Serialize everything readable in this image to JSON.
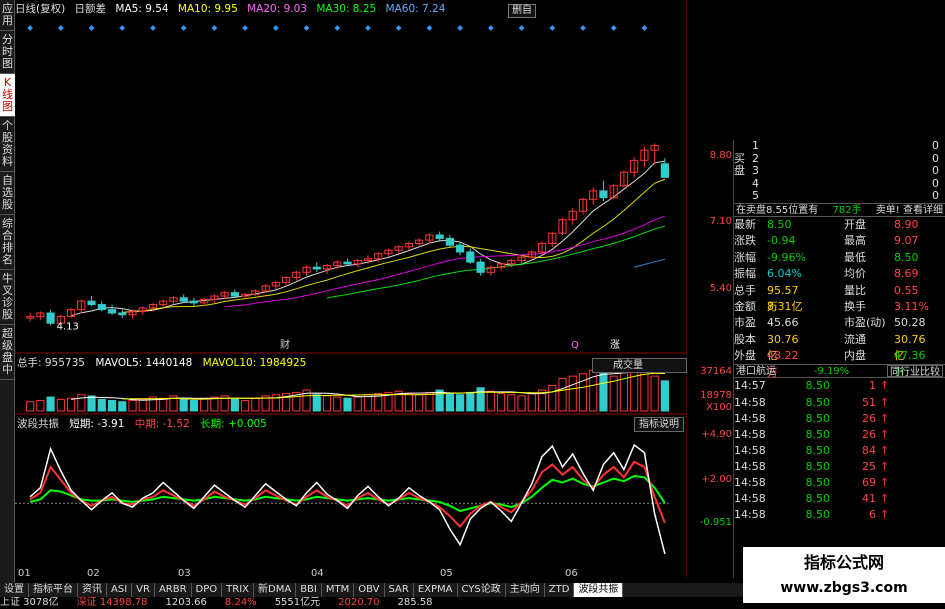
{
  "side_tabs": [
    "应用",
    "分时图",
    "K线图",
    "个股资料",
    "自选股",
    "综合排名",
    "牛叉诊股",
    "超级盘中"
  ],
  "side_active": 2,
  "topbar": {
    "stock": "日线(复权)",
    "mode": "日额差",
    "ma5": "MA5: 9.54",
    "ma10": "MA10: 9.95",
    "ma20": "MA20: 9.03",
    "ma30": "MA30: 8.25",
    "ma60": "MA60: 7.24",
    "btn": "删自"
  },
  "kline_labels": {
    "low_price": "4.13",
    "mark1": "财",
    "mark2": "Q",
    "mark3": "涨"
  },
  "price_axis": [
    "8.80",
    "7.10",
    "5.40"
  ],
  "volume": {
    "total": "总手: 955735",
    "mavol5": "MAVOL5: 1440148",
    "mavol10": "MAVOL10: 1984925",
    "select": "成交量",
    "axis": [
      "37164",
      "18978",
      "X100"
    ]
  },
  "indicator": {
    "name": "波段共振",
    "short": "短期: -3.91",
    "mid": "中期: -1.52",
    "long": "长期: +0.005",
    "btn": "指标说明",
    "axis": [
      "+4.90",
      "+2.00",
      "-0.951"
    ]
  },
  "dates": [
    "01",
    "02",
    "03",
    "04",
    "05",
    "06"
  ],
  "order_book": {
    "buy": [
      {
        "n": "1",
        "v": "0"
      },
      {
        "n": "2",
        "v": "0"
      },
      {
        "n": "3",
        "v": "0"
      },
      {
        "n": "4",
        "v": "0"
      },
      {
        "n": "5",
        "v": "0"
      }
    ],
    "buy_label": "买盘",
    "header_left": "在卖盘8.55位置有",
    "header_mid": "782手",
    "header_right": "卖单! 查看详细"
  },
  "quote": [
    {
      "k1": "最新",
      "v1": "8.50",
      "c1": "g",
      "k2": "开盘",
      "v2": "8.90",
      "c2": "r"
    },
    {
      "k1": "涨跌",
      "v1": "-0.94",
      "c1": "g",
      "k2": "最高",
      "v2": "9.07",
      "c2": "r"
    },
    {
      "k1": "涨幅",
      "v1": "-9.96%",
      "c1": "g",
      "k2": "最低",
      "v2": "8.50",
      "c2": "g"
    },
    {
      "k1": "振幅",
      "v1": "6.04%",
      "c1": "c",
      "k2": "均价",
      "v2": "8.69",
      "c2": "r"
    },
    {
      "k1": "总手",
      "v1": "95.57万",
      "c1": "y",
      "k2": "量比",
      "v2": "0.55",
      "c2": "r"
    },
    {
      "k1": "金额",
      "v1": "8.31亿",
      "c1": "y",
      "k2": "换手",
      "v2": "3.11%",
      "c2": "r"
    },
    {
      "k1": "市盈",
      "v1": "45.66",
      "c1": "w",
      "k2": "市盈(动)",
      "v2": "50.28",
      "c2": "w"
    },
    {
      "k1": "股本",
      "v1": "30.76亿",
      "c1": "y",
      "k2": "流通",
      "v2": "30.76亿",
      "c2": "y"
    },
    {
      "k1": "外盘",
      "v1": "48.22万",
      "c1": "r",
      "k2": "内盘",
      "v2": "47.36万",
      "c2": "g"
    }
  ],
  "sector": {
    "name": "港口航运",
    "pct": "-9.19%",
    "btn": "同行业比较"
  },
  "ticks": [
    {
      "t": "14:57",
      "p": "8.50",
      "v": "1"
    },
    {
      "t": "14:58",
      "p": "8.50",
      "v": "51"
    },
    {
      "t": "14:58",
      "p": "8.50",
      "v": "26"
    },
    {
      "t": "14:58",
      "p": "8.50",
      "v": "26"
    },
    {
      "t": "14:58",
      "p": "8.50",
      "v": "84"
    },
    {
      "t": "14:58",
      "p": "8.50",
      "v": "25"
    },
    {
      "t": "14:58",
      "p": "8.50",
      "v": "69"
    },
    {
      "t": "14:58",
      "p": "8.50",
      "v": "41"
    },
    {
      "t": "14:58",
      "p": "8.50",
      "v": "6"
    }
  ],
  "bottom_tabs": [
    "设置",
    "指标平台",
    "资讯",
    "ASI",
    "VR",
    "ARBR",
    "DPO",
    "TRIX",
    "新DMA",
    "BBI",
    "MTM",
    "OBV",
    "SAR",
    "EXPMA",
    "CYS论政",
    "主动向",
    "ZTD",
    "波段共振"
  ],
  "bottom_active": 17,
  "status": [
    "上证 3078亿",
    "深证 14398.78",
    "1203.66",
    "8.24%",
    "5551亿元",
    "2020.70",
    "285.58"
  ],
  "watermark": {
    "line1": "指标公式网",
    "line2": "www.zbgs3.com"
  },
  "chart_data": {
    "type": "candlestick",
    "price_ylim": [
      4.0,
      9.6
    ],
    "candles": [
      [
        4.35,
        4.5,
        4.25,
        4.4
      ],
      [
        4.4,
        4.55,
        4.3,
        4.5
      ],
      [
        4.5,
        4.6,
        4.13,
        4.2
      ],
      [
        4.2,
        4.45,
        4.15,
        4.4
      ],
      [
        4.4,
        4.65,
        4.35,
        4.6
      ],
      [
        4.6,
        4.9,
        4.5,
        4.85
      ],
      [
        4.85,
        5.0,
        4.7,
        4.75
      ],
      [
        4.75,
        4.85,
        4.55,
        4.6
      ],
      [
        4.6,
        4.75,
        4.45,
        4.5
      ],
      [
        4.5,
        4.6,
        4.35,
        4.45
      ],
      [
        4.45,
        4.6,
        4.35,
        4.55
      ],
      [
        4.55,
        4.7,
        4.45,
        4.65
      ],
      [
        4.65,
        4.8,
        4.55,
        4.75
      ],
      [
        4.75,
        4.9,
        4.65,
        4.85
      ],
      [
        4.85,
        5.0,
        4.75,
        4.95
      ],
      [
        4.95,
        5.05,
        4.8,
        4.85
      ],
      [
        4.85,
        4.95,
        4.7,
        4.8
      ],
      [
        4.8,
        4.95,
        4.7,
        4.9
      ],
      [
        4.9,
        5.05,
        4.8,
        5.0
      ],
      [
        5.0,
        5.15,
        4.9,
        5.1
      ],
      [
        5.1,
        5.2,
        4.95,
        5.0
      ],
      [
        5.0,
        5.1,
        4.9,
        5.05
      ],
      [
        5.05,
        5.2,
        5.0,
        5.15
      ],
      [
        5.15,
        5.35,
        5.1,
        5.3
      ],
      [
        5.3,
        5.45,
        5.2,
        5.4
      ],
      [
        5.4,
        5.6,
        5.3,
        5.55
      ],
      [
        5.55,
        5.75,
        5.45,
        5.7
      ],
      [
        5.7,
        5.9,
        5.6,
        5.85
      ],
      [
        5.85,
        6.0,
        5.7,
        5.8
      ],
      [
        5.8,
        5.95,
        5.65,
        5.9
      ],
      [
        5.9,
        6.05,
        5.8,
        6.0
      ],
      [
        6.0,
        6.1,
        5.9,
        5.95
      ],
      [
        5.95,
        6.1,
        5.85,
        6.05
      ],
      [
        6.05,
        6.2,
        5.95,
        6.1
      ],
      [
        6.1,
        6.3,
        6.0,
        6.25
      ],
      [
        6.25,
        6.4,
        6.15,
        6.35
      ],
      [
        6.35,
        6.5,
        6.25,
        6.45
      ],
      [
        6.45,
        6.6,
        6.35,
        6.55
      ],
      [
        6.55,
        6.7,
        6.45,
        6.65
      ],
      [
        6.65,
        6.85,
        6.55,
        6.8
      ],
      [
        6.8,
        6.9,
        6.6,
        6.7
      ],
      [
        6.7,
        6.8,
        6.45,
        6.5
      ],
      [
        6.5,
        6.6,
        6.2,
        6.3
      ],
      [
        6.3,
        6.4,
        5.95,
        6.0
      ],
      [
        6.0,
        6.1,
        5.6,
        5.7
      ],
      [
        5.7,
        5.9,
        5.6,
        5.85
      ],
      [
        5.85,
        6.0,
        5.75,
        5.95
      ],
      [
        5.95,
        6.1,
        5.85,
        6.05
      ],
      [
        6.05,
        6.2,
        5.95,
        6.15
      ],
      [
        6.15,
        6.35,
        6.05,
        6.3
      ],
      [
        6.3,
        6.6,
        6.2,
        6.55
      ],
      [
        6.55,
        6.9,
        6.45,
        6.85
      ],
      [
        6.85,
        7.3,
        6.8,
        7.25
      ],
      [
        7.25,
        7.6,
        7.1,
        7.5
      ],
      [
        7.5,
        7.9,
        7.4,
        7.85
      ],
      [
        7.85,
        8.2,
        7.7,
        8.1
      ],
      [
        8.1,
        8.4,
        7.8,
        7.9
      ],
      [
        7.9,
        8.3,
        7.85,
        8.25
      ],
      [
        8.25,
        8.7,
        8.2,
        8.65
      ],
      [
        8.65,
        9.1,
        8.5,
        9.0
      ],
      [
        9.0,
        9.4,
        8.8,
        9.3
      ],
      [
        9.3,
        9.5,
        8.9,
        9.44
      ],
      [
        8.9,
        9.07,
        8.5,
        8.5
      ]
    ],
    "volume_values": [
      8,
      9,
      12,
      10,
      11,
      14,
      13,
      10,
      9,
      8,
      9,
      10,
      12,
      11,
      13,
      10,
      9,
      11,
      12,
      13,
      10,
      9,
      11,
      13,
      14,
      15,
      16,
      18,
      14,
      13,
      12,
      11,
      12,
      14,
      15,
      16,
      17,
      15,
      14,
      16,
      18,
      15,
      14,
      16,
      20,
      17,
      15,
      14,
      13,
      15,
      18,
      22,
      28,
      30,
      32,
      35,
      33,
      30,
      34,
      36,
      37,
      30,
      26
    ],
    "indicator_short": [
      0.5,
      1.2,
      4.2,
      2.5,
      1.0,
      0.2,
      -0.5,
      0.2,
      0.8,
      0.0,
      -0.3,
      0.4,
      0.8,
      1.6,
      0.9,
      0.2,
      -0.4,
      0.5,
      1.4,
      0.8,
      0.2,
      -0.3,
      0.6,
      1.5,
      0.9,
      0.3,
      -0.2,
      0.8,
      1.6,
      0.7,
      0.2,
      -0.4,
      0.6,
      1.3,
      0.5,
      -0.2,
      0.4,
      1.2,
      0.6,
      0.1,
      -0.5,
      -2.0,
      -3.2,
      -1.2,
      -0.4,
      0.1,
      -0.6,
      -1.4,
      0.0,
      1.5,
      3.6,
      4.4,
      2.8,
      3.8,
      2.3,
      1.0,
      3.0,
      3.9,
      2.6,
      4.5,
      3.9,
      -0.8,
      -3.91
    ],
    "indicator_mid": [
      0.3,
      0.8,
      2.8,
      1.8,
      0.8,
      0.2,
      -0.2,
      0.2,
      0.5,
      0.0,
      -0.1,
      0.3,
      0.5,
      1.0,
      0.6,
      0.2,
      -0.2,
      0.3,
      0.9,
      0.5,
      0.2,
      -0.1,
      0.4,
      1.0,
      0.6,
      0.2,
      -0.1,
      0.5,
      1.0,
      0.5,
      0.2,
      -0.2,
      0.4,
      0.8,
      0.3,
      -0.1,
      0.3,
      0.8,
      0.4,
      0.1,
      -0.3,
      -1.0,
      -1.8,
      -0.8,
      -0.2,
      0.1,
      -0.3,
      -0.7,
      0.1,
      1.0,
      2.4,
      3.0,
      2.2,
      2.8,
      1.8,
      1.2,
      2.2,
      2.8,
      2.0,
      3.2,
      2.8,
      0.5,
      -1.52
    ],
    "indicator_long": [
      0.1,
      0.3,
      1.0,
      0.9,
      0.6,
      0.3,
      0.2,
      0.2,
      0.3,
      0.2,
      0.1,
      0.2,
      0.3,
      0.5,
      0.4,
      0.3,
      0.2,
      0.3,
      0.5,
      0.4,
      0.3,
      0.2,
      0.3,
      0.5,
      0.4,
      0.3,
      0.2,
      0.3,
      0.5,
      0.4,
      0.3,
      0.2,
      0.3,
      0.4,
      0.3,
      0.2,
      0.3,
      0.4,
      0.3,
      0.2,
      0.1,
      -0.2,
      -0.6,
      -0.4,
      -0.2,
      0.0,
      -0.1,
      -0.3,
      0.0,
      0.5,
      1.2,
      1.8,
      1.6,
      1.9,
      1.5,
      1.3,
      1.6,
      1.9,
      1.7,
      2.1,
      2.0,
      1.2,
      0.005
    ],
    "indicator_ylim": [
      -5.0,
      5.5
    ]
  },
  "colors": {
    "up": "#ff3333",
    "down": "#33cccc",
    "ma": [
      "#ffffff",
      "#ffff00",
      "#ff00ff",
      "#00ff00",
      "#3399ff"
    ]
  }
}
